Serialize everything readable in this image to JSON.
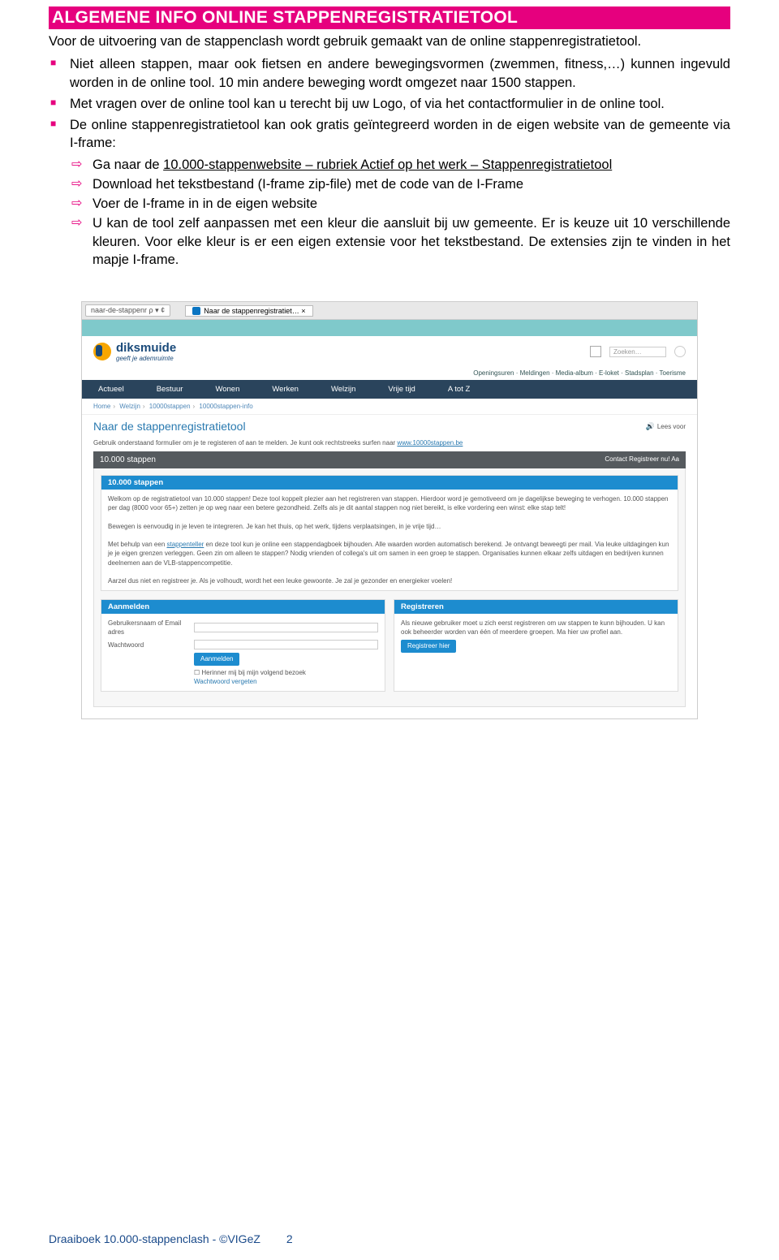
{
  "title": "ALGEMENE INFO ONLINE STAPPENREGISTRATIETOOL",
  "intro": "Voor de uitvoering van de stappenclash wordt gebruik gemaakt van de online stappenregistratietool.",
  "bullets": [
    "Niet alleen stappen, maar ook fietsen en andere bewegingsvormen (zwemmen, fitness,…) kunnen ingevuld worden in de online tool. 10 min andere beweging wordt omgezet naar 1500 stappen.",
    "Met vragen over de online tool kan u terecht bij uw Logo, of via het contactformulier in de online tool.",
    "De online stappenregistratietool kan ook gratis geïntegreerd worden in de eigen website van de gemeente via I-frame:"
  ],
  "sub_bullets": {
    "first_link": "Ga naar de ",
    "first_link_text": "10.000-stappenwebsite – rubriek Actief op het werk – Stappenregistratietool",
    "s2": "Download het tekstbestand (I-frame zip-file) met de code van de I-Frame",
    "s3": "Voer de I-frame in in de eigen website",
    "s4": "U kan de tool zelf aanpassen met een kleur die aansluit bij uw gemeente. Er is keuze uit 10 verschillende kleuren. Voor elke kleur is er een eigen extensie voor het tekstbestand. De extensies zijn te vinden in het mapje I-frame."
  },
  "screenshot": {
    "ie_addr": "naar-de-stappenr  ρ ▾ ¢",
    "ie_tab": "Naar de stappenregistratiet… ×",
    "logo": "diksmuide",
    "logo_sub": "geeft je ademruimte",
    "search_placeholder": "Zoeken…",
    "toplinks": "Openingsuren · Meldingen · Media-album · E-loket · Stadsplan · Toerisme",
    "nav": [
      "Actueel",
      "Bestuur",
      "Wonen",
      "Werken",
      "Welzijn",
      "Vrije tijd",
      "A tot Z"
    ],
    "breadcrumb": [
      "Home",
      "Welzijn",
      "10000stappen",
      "10000stappen-info"
    ],
    "page_title": "Naar de stappenregistratietool",
    "lees": "Lees voor",
    "subtext_pre": "Gebruik onderstaand formulier om je te registeren of aan te melden. Je kunt ook rechtstreeks surfen naar ",
    "subtext_link": "www.10000stappen.be",
    "toolbar_title": "10.000 stappen",
    "toolbar_right": "Contact  Registreer nu!  Aa",
    "intro_panel_title": "10.000 stappen",
    "intro_panel_body": "Welkom op de registratietool van 10.000 stappen! Deze tool koppelt plezier aan het registreren van stappen. Hierdoor word je gemotiveerd om je dagelijkse beweging te verhogen. 10.000 stappen per dag (8000 voor 65+) zetten je op weg naar een betere gezondheid. Zelfs als je dit aantal stappen nog niet bereikt, is elke vordering een winst: elke stap telt!",
    "intro_panel_body2": "Bewegen is eenvoudig in je leven te integreren. Je kan het thuis, op het werk, tijdens verplaatsingen, in je vrije tijd…",
    "intro_panel_body3_pre": "Met behulp van een ",
    "intro_panel_body3_link": "stappenteller",
    "intro_panel_body3_post": " en deze tool kun je online een stappendagboek bijhouden. Alle waarden worden automatisch berekend. Je ontvangt beweegti per mail. Via leuke uitdagingen kun je je eigen grenzen verleggen. Geen zin om alleen te stappen? Nodig vrienden of collega's uit om samen in een groep te stappen. Organisaties kunnen elkaar zelfs uitdagen en bedrijven kunnen deelnemen aan de VLB-stappencompetitie.",
    "intro_panel_body4": "Aarzel dus niet en registreer je. Als je volhoudt, wordt het een leuke gewoonte. Je zal je gezonder en energieker voelen!",
    "login": {
      "title": "Aanmelden",
      "user_label": "Gebruikersnaam of Email adres",
      "pass_label": "Wachtwoord",
      "button": "Aanmelden",
      "remember": "Herinner mij bij mijn volgend bezoek",
      "forgot": "Wachtwoord vergeten"
    },
    "register": {
      "title": "Registreren",
      "body": "Als nieuwe gebruiker moet u zich eerst registreren om uw stappen te kunn bijhouden. U kan ook beheerder worden van één of meerdere groepen. Ma hier uw profiel aan.",
      "button": "Registreer hier"
    }
  },
  "footer": {
    "left": "Draaiboek 10.000-stappenclash - ©VIGeZ",
    "page": "2"
  }
}
